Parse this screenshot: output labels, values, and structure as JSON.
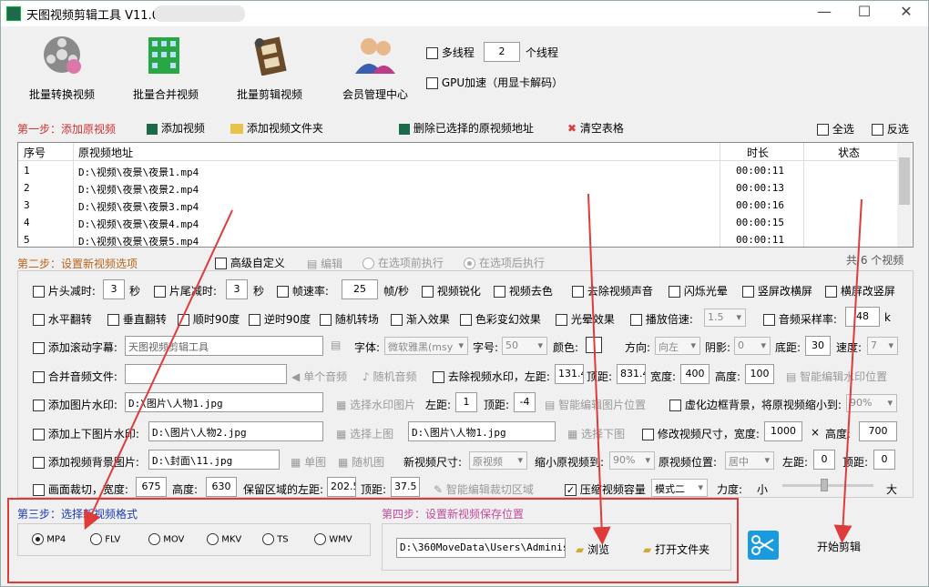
{
  "title": "天图视频剪辑工具 V11.0",
  "toolbar": {
    "b1": "批量转换视频",
    "b2": "批量合并视频",
    "b3": "批量剪辑视频",
    "b4": "会员管理中心"
  },
  "thread": {
    "label": "多线程",
    "value": "2",
    "unit": "个线程",
    "gpu": "GPU加速（用显卡解码）"
  },
  "step1": {
    "title": "第一步：添加原视频",
    "add": "添加视频",
    "add_folder": "添加视频文件夹",
    "delete": "删除已选择的原视频地址",
    "clear": "清空表格",
    "select_all": "全选",
    "invert": "反选"
  },
  "table": {
    "h_no": "序号",
    "h_path": "原视频地址",
    "h_dur": "时长",
    "h_status": "状态",
    "rows": [
      [
        "1",
        "D:\\视频\\夜景\\夜景1.mp4",
        "00:00:11"
      ],
      [
        "2",
        "D:\\视频\\夜景\\夜景2.mp4",
        "00:00:13"
      ],
      [
        "3",
        "D:\\视频\\夜景\\夜景3.mp4",
        "00:00:16"
      ],
      [
        "4",
        "D:\\视频\\夜景\\夜景4.mp4",
        "00:00:15"
      ],
      [
        "5",
        "D:\\视频\\夜景\\夜景5.mp4",
        "00:00:11"
      ]
    ]
  },
  "step2": {
    "title": "第二步：设置新视频选项",
    "advanced": "高级自定义",
    "edit": "编辑",
    "before": "在选项前执行",
    "after": "在选项后执行",
    "count": "共 6 个视频"
  },
  "r1": {
    "head": "片头减时:",
    "head_v": "3",
    "sec": "秒",
    "tail": "片尾减时:",
    "tail_v": "3",
    "fps": "帧速率:",
    "fps_v": "25",
    "fps_u": "帧/秒",
    "sharpen": "视频锐化",
    "decolor": "视频去色",
    "mute": "去除视频声音",
    "flash": "闪烁光晕",
    "v2h": "竖屏改横屏",
    "h2v": "横屏改竖屏"
  },
  "r2": {
    "hflip": "水平翻转",
    "vflip": "垂直翻转",
    "cw90": "顺时90度",
    "ccw90": "逆时90度",
    "rand": "随机转场",
    "fadein": "渐入效果",
    "color": "色彩变幻效果",
    "halo": "光晕效果",
    "speed": "播放倍速:",
    "speed_v": "1.5",
    "rate": "音频采样率:",
    "rate_v": "48",
    "rate_u": "k"
  },
  "r3": {
    "scroll": "添加滚动字幕:",
    "text": "天图视频剪辑工具",
    "font": "字体:",
    "font_v": "微软雅黑(msy",
    "size": "字号:",
    "size_v": "50",
    "color": "颜色:",
    "dir": "方向:",
    "dir_v": "向左",
    "shadow": "阴影:",
    "shadow_v": "0",
    "bottom": "底距:",
    "bottom_v": "30",
    "spd": "速度:",
    "spd_v": "7"
  },
  "r4": {
    "audio": "合并音频文件:",
    "single": "单个音频",
    "random": "随机音频",
    "wm": "去除视频水印，左距:",
    "left_v": "131.4",
    "top": "顶距:",
    "top_v": "831.4",
    "w": "宽度:",
    "w_v": "400",
    "h": "高度:",
    "h_v": "100",
    "smart": "智能编辑水印位置"
  },
  "r5": {
    "img": "添加图片水印:",
    "path": "D:\\图片\\人物1.jpg",
    "choose": "选择水印图片",
    "left": "左距:",
    "left_v": "1",
    "top": "顶距:",
    "top_v": "-4",
    "smart": "智能编辑图片位置",
    "blur": "虚化边框背景，将原视频缩小到:",
    "blur_v": "90%"
  },
  "r6": {
    "tb": "添加上下图片水印:",
    "top_path": "D:\\图片\\人物2.jpg",
    "choose_top": "选择上图",
    "bot_path": "D:\\图片\\人物1.jpg",
    "choose_bot": "选择下图",
    "resize": "修改视频尺寸，宽度:",
    "w_v": "1000",
    "x": "×",
    "h": "高度:",
    "h_v": "700"
  },
  "r7": {
    "bg": "添加视频背景图片:",
    "path": "D:\\封面\\11.jpg",
    "single": "单图",
    "random": "随机图",
    "new_size": "新视频尺寸:",
    "new_size_v": "原视频",
    "shrink": "缩小原视频到:",
    "shrink_v": "90%",
    "pos": "原视频位置:",
    "pos_v": "居中",
    "left": "左距:",
    "left_v": "0",
    "top": "顶距:",
    "top_v": "0"
  },
  "r8": {
    "crop": "画面裁切，宽度:",
    "w_v": "675",
    "h": "高度:",
    "h_v": "630",
    "keep": "保留区域的左距:",
    "left_v": "202.5",
    "top": "顶距:",
    "top_v": "37.5",
    "smart": "智能编辑裁切区域",
    "compress": "压缩视频容量",
    "mode_v": "模式二",
    "force": "力度:",
    "small": "小",
    "big": "大"
  },
  "step3": {
    "title": "第三步：选择新视频格式",
    "formats": [
      "MP4",
      "FLV",
      "MOV",
      "MKV",
      "TS",
      "WMV"
    ]
  },
  "step4": {
    "title": "第四步：设置新视频保存位置",
    "path": "D:\\360MoveData\\Users\\Administr",
    "browse": "浏览",
    "open": "打开文件夹"
  },
  "start": "开始剪辑",
  "colors": {
    "accent_red": "#e03b3b",
    "step_red": "#c33",
    "step_blue": "#1a3bb3",
    "step_mag": "#c04a9a"
  }
}
